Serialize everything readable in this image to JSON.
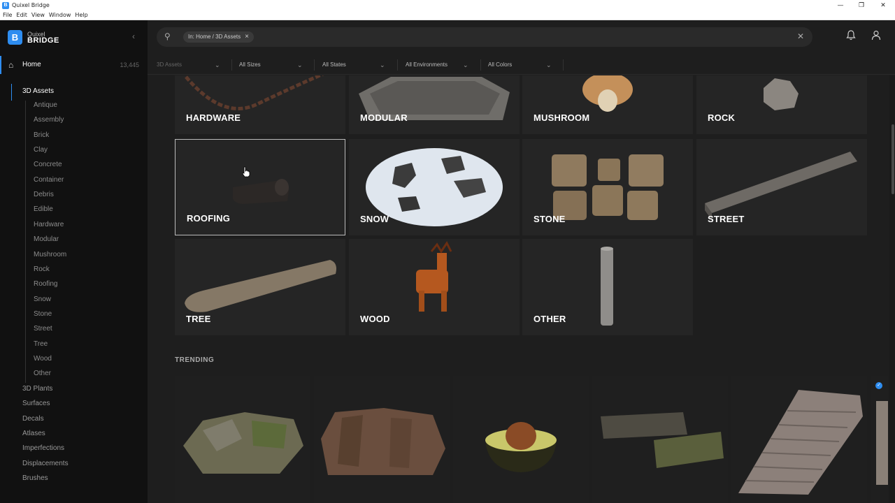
{
  "window": {
    "title": "Quixel Bridge",
    "minimize": "—",
    "restore": "❐",
    "close": "✕"
  },
  "menu": [
    "File",
    "Edit",
    "View",
    "Window",
    "Help"
  ],
  "brand": {
    "line1": "Quixel",
    "line2": "BRIDGE",
    "logo": "B"
  },
  "sidebar": {
    "home_label": "Home",
    "home_count": "13,445",
    "active_category": "3D Assets",
    "subcategories": [
      "Antique",
      "Assembly",
      "Brick",
      "Clay",
      "Concrete",
      "Container",
      "Debris",
      "Edible",
      "Hardware",
      "Modular",
      "Mushroom",
      "Rock",
      "Roofing",
      "Snow",
      "Stone",
      "Street",
      "Tree",
      "Wood",
      "Other"
    ],
    "categories": [
      "3D Plants",
      "Surfaces",
      "Decals",
      "Atlases",
      "Imperfections",
      "Displacements",
      "Brushes"
    ]
  },
  "search": {
    "chip": "In: Home / 3D Assets"
  },
  "filters": [
    "3D Assets",
    "All Sizes",
    "All States",
    "All Environments",
    "All Colors"
  ],
  "grid": [
    "HARDWARE",
    "MODULAR",
    "MUSHROOM",
    "ROCK",
    "ROOFING",
    "SNOW",
    "STONE",
    "STREET",
    "TREE",
    "WOOD",
    "OTHER"
  ],
  "trending_title": "TRENDING",
  "colors": {
    "accent": "#2e8df0",
    "sidebar_bg": "#111111",
    "content_bg": "#1e1e1e",
    "card_bg": "#252525"
  }
}
